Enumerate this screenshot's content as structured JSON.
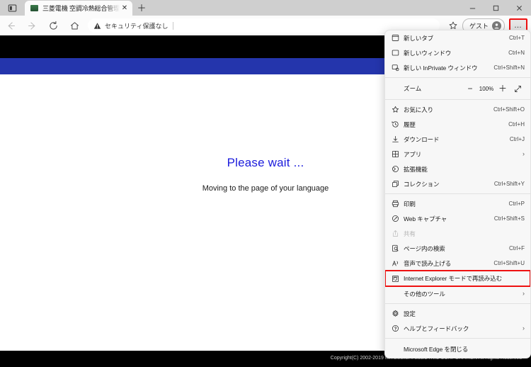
{
  "window": {
    "controls": [
      {
        "name": "minimize",
        "glyph": "minimize-icon"
      },
      {
        "name": "maximize",
        "glyph": "maximize-icon"
      },
      {
        "name": "close",
        "glyph": "close-icon"
      }
    ]
  },
  "tabstrip": {
    "tab_search_icon": "tab-search-icon",
    "tabs": [
      {
        "title": "三菱電機 空調冷熱総合管理システ",
        "close_label": "✕"
      }
    ],
    "new_tab_label": "＋"
  },
  "toolbar": {
    "back_icon": "back-arrow-icon",
    "forward_icon": "forward-arrow-icon",
    "refresh_icon": "refresh-icon",
    "home_icon": "home-icon",
    "security_label": "セキュリティ保護なし",
    "security_icon": "warning-triangle-icon",
    "favorite_icon": "star-icon",
    "profile_label": "ゲスト",
    "profile_avatar_icon": "avatar-icon",
    "more_label": "…",
    "more_icon": "ellipsis-icon",
    "highlight_color": "#ee1111"
  },
  "page": {
    "header_color": "#000000",
    "accent_color": "#2435ac",
    "heading": "Please wait ...",
    "heading_color": "#1b1bdc",
    "subheading": "Moving to the page of your language",
    "footer_text": "Copyright(C) 2002-2019 MITSUBISHI ELECTRIC CORPORATION All Rights Reserved"
  },
  "menu": {
    "items": [
      {
        "id": "new-tab",
        "icon": "new-tab-icon",
        "label": "新しいタブ",
        "accel": "Ctrl+T",
        "chevron": false,
        "disabled": false
      },
      {
        "id": "new-window",
        "icon": "new-window-icon",
        "label": "新しいウィンドウ",
        "accel": "Ctrl+N",
        "chevron": false,
        "disabled": false
      },
      {
        "id": "new-inprivate",
        "icon": "inprivate-icon",
        "label": "新しい InPrivate ウィンドウ",
        "accel": "Ctrl+Shift+N",
        "chevron": false,
        "disabled": false
      },
      {
        "id": "zoom",
        "icon": "zoom-row",
        "label": "ズーム",
        "accel": "",
        "chevron": false,
        "disabled": false
      },
      {
        "id": "favorites",
        "icon": "star-icon",
        "label": "お気に入り",
        "accel": "Ctrl+Shift+O",
        "chevron": false,
        "disabled": false
      },
      {
        "id": "history",
        "icon": "history-clock-icon",
        "label": "履歴",
        "accel": "Ctrl+H",
        "chevron": false,
        "disabled": false
      },
      {
        "id": "downloads",
        "icon": "download-icon",
        "label": "ダウンロード",
        "accel": "Ctrl+J",
        "chevron": false,
        "disabled": false
      },
      {
        "id": "apps",
        "icon": "apps-grid-icon",
        "label": "アプリ",
        "accel": "",
        "chevron": true,
        "disabled": false
      },
      {
        "id": "extensions",
        "icon": "extensions-icon",
        "label": "拡張機能",
        "accel": "",
        "chevron": false,
        "disabled": false
      },
      {
        "id": "collections",
        "icon": "collections-icon",
        "label": "コレクション",
        "accel": "Ctrl+Shift+Y",
        "chevron": false,
        "disabled": false
      },
      {
        "id": "print",
        "icon": "printer-icon",
        "label": "印刷",
        "accel": "Ctrl+P",
        "chevron": false,
        "disabled": false
      },
      {
        "id": "web-capture",
        "icon": "web-capture-icon",
        "label": "Web キャプチャ",
        "accel": "Ctrl+Shift+S",
        "chevron": false,
        "disabled": false
      },
      {
        "id": "share",
        "icon": "share-icon",
        "label": "共有",
        "accel": "",
        "chevron": false,
        "disabled": true
      },
      {
        "id": "find-in-page",
        "icon": "find-page-icon",
        "label": "ページ内の検索",
        "accel": "Ctrl+F",
        "chevron": false,
        "disabled": false
      },
      {
        "id": "read-aloud",
        "icon": "read-aloud-icon",
        "label": "音声で読み上げる",
        "accel": "Ctrl+Shift+U",
        "chevron": false,
        "disabled": false
      },
      {
        "id": "ie-mode",
        "icon": "ie-mode-icon",
        "label": "Internet Explorer モードで再読み込む",
        "accel": "",
        "chevron": false,
        "disabled": false
      },
      {
        "id": "more-tools",
        "icon": "",
        "label": "その他のツール",
        "accel": "",
        "chevron": true,
        "disabled": false
      },
      {
        "id": "settings",
        "icon": "gear-icon",
        "label": "設定",
        "accel": "",
        "chevron": false,
        "disabled": false
      },
      {
        "id": "help-feedback",
        "icon": "help-circle-icon",
        "label": "ヘルプとフィードバック",
        "accel": "",
        "chevron": true,
        "disabled": false
      },
      {
        "id": "close-edge",
        "icon": "",
        "label": "Microsoft Edge を閉じる",
        "accel": "",
        "chevron": false,
        "disabled": false
      }
    ],
    "zoom": {
      "label": "ズーム",
      "minus_label": "−",
      "value": "100%",
      "plus_label": "＋",
      "fullscreen_icon": "fullscreen-icon"
    },
    "highlighted_item_id": "ie-mode",
    "highlight_color": "#ee1111"
  }
}
